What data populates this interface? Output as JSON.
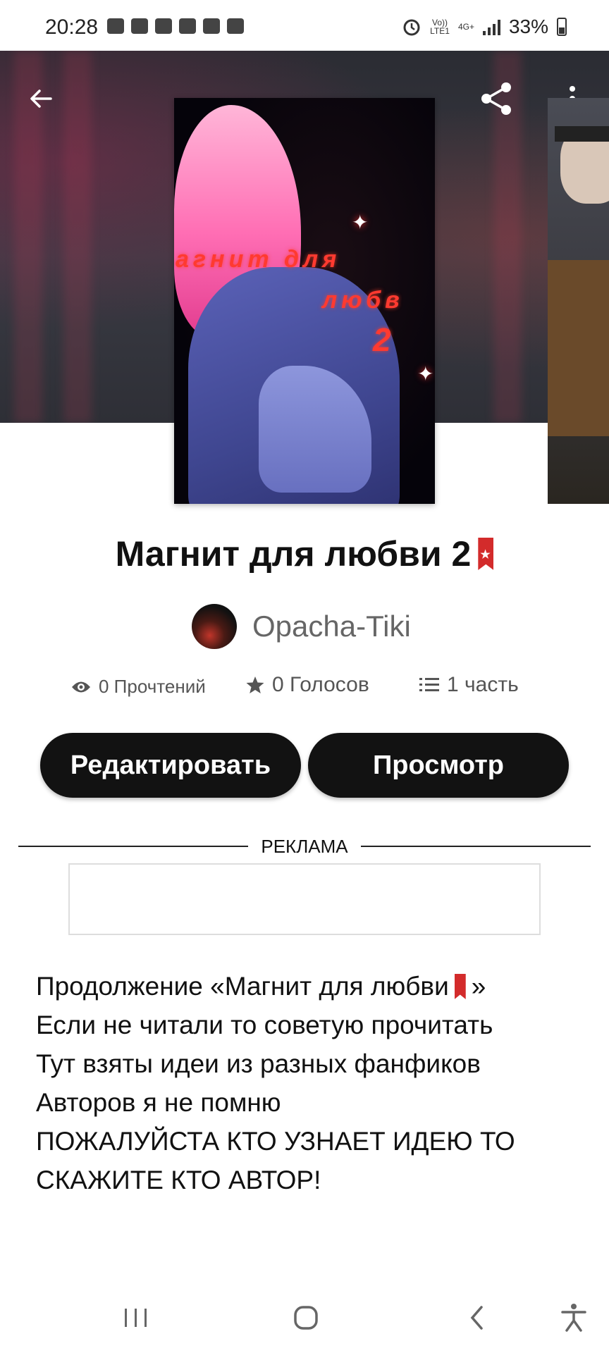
{
  "status_bar": {
    "time": "20:28",
    "network_top": "Vo))",
    "network_bottom": "LTE1",
    "data_type": "4G+",
    "battery": "33%"
  },
  "header": {
    "back_icon": "arrow-left-icon",
    "share_icon": "share-icon",
    "more_icon": "more-vertical-icon"
  },
  "cover": {
    "line1": "агнит для",
    "line2": "любв",
    "line3": "2"
  },
  "story": {
    "title": "Магнит для любви 2",
    "author": "Opacha-Tiki"
  },
  "stats": {
    "reads": "0 Прочтений",
    "votes": "0 Голосов",
    "parts": "1 часть"
  },
  "buttons": {
    "edit": "Редактировать",
    "view": "Просмотр"
  },
  "ad": {
    "label": "РЕКЛАМА"
  },
  "description": {
    "line1_pre": "Продолжение «Магнит для любви",
    "line1_post": "»",
    "line2": "Если не читали то советую прочитать",
    "line3": "Тут взяты идеи из разных фанфиков",
    "line4": "Авторов я не помню",
    "line5": "ПОЖАЛУЙСТА КТО УЗНАЕТ ИДЕЮ ТО",
    "line6": "СКАЖИТЕ КТО АВТОР!"
  },
  "colors": {
    "button_bg": "#121212",
    "bookmark_red": "#d32b2b"
  }
}
